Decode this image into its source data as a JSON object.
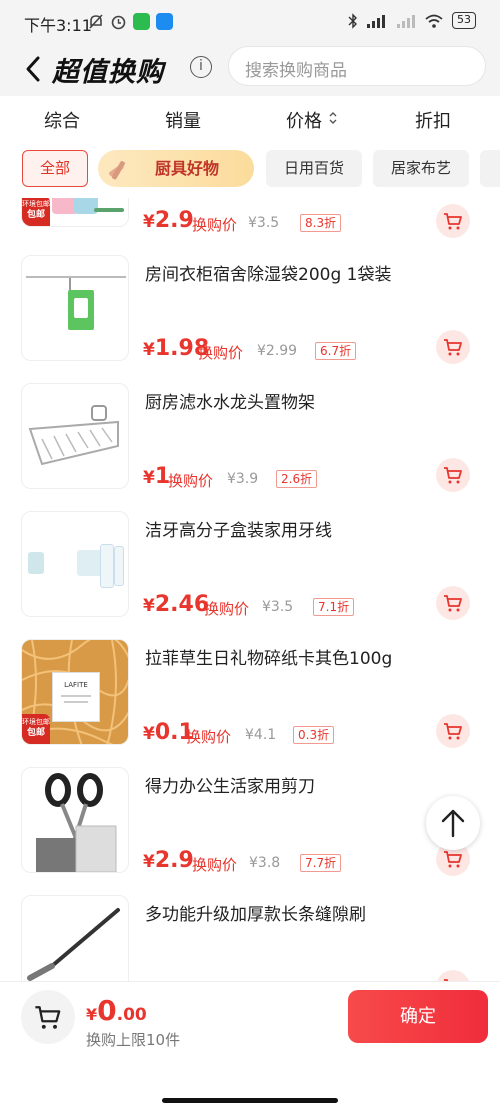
{
  "status_bar": {
    "time": "下午3:11",
    "battery": "53"
  },
  "header": {
    "title": "超值换购",
    "info_glyph": "i",
    "search_placeholder": "搜索换购商品"
  },
  "sort_tabs": [
    {
      "label": "综合"
    },
    {
      "label": "销量"
    },
    {
      "label": "价格"
    },
    {
      "label": "折扣"
    }
  ],
  "categories": [
    {
      "label": "全部",
      "selected": true
    },
    {
      "label": "厨具好物"
    },
    {
      "label": "日用百货"
    },
    {
      "label": "居家布艺"
    }
  ],
  "price_label": "换购价",
  "products": [
    {
      "name": "",
      "currency": "¥",
      "price": "2.9",
      "original": "¥3.5",
      "discount": "8.3折",
      "tag_top": "环境包邮",
      "tag_bottom": "包邮"
    },
    {
      "name": "房间衣柜宿舍除湿袋200g 1袋装",
      "currency": "¥",
      "price": "1.98",
      "original": "¥2.99",
      "discount": "6.7折"
    },
    {
      "name": "厨房滤水水龙头置物架",
      "currency": "¥",
      "price": "1",
      "original": "¥3.9",
      "discount": "2.6折"
    },
    {
      "name": "洁牙高分子盒装家用牙线",
      "currency": "¥",
      "price": "2.46",
      "original": "¥3.5",
      "discount": "7.1折"
    },
    {
      "name": "拉菲草生日礼物碎纸卡其色100g",
      "currency": "¥",
      "price": "0.1",
      "original": "¥4.1",
      "discount": "0.3折",
      "tag_top": "环境包邮",
      "tag_bottom": "包邮",
      "pack_text": "LAFITE"
    },
    {
      "name": "得力办公生活家用剪刀",
      "currency": "¥",
      "price": "2.9",
      "original": "¥3.8",
      "discount": "7.7折"
    },
    {
      "name": "多功能升级加厚款长条缝隙刷"
    }
  ],
  "bottom_bar": {
    "currency": "¥",
    "total_int": "0",
    "total_dec": ".00",
    "limit_text": "换购上限10件",
    "confirm_label": "确定"
  },
  "colors": {
    "accent": "#e8352d",
    "confirm": "#f23a40"
  }
}
